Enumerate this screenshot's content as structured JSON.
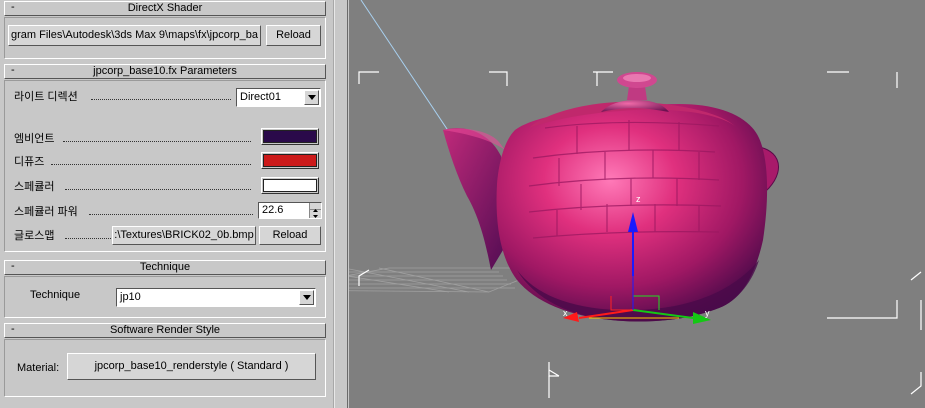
{
  "rollouts": {
    "directx": {
      "title": "DirectX Shader",
      "collapse": "-",
      "path": "gram Files\\Autodesk\\3ds Max 9\\maps\\fx\\jpcorp_ba",
      "reload": "Reload"
    },
    "params": {
      "title": "jpcorp_base10.fx Parameters",
      "collapse": "-",
      "light_label": "라이트 디렉션",
      "light_value": "Direct01",
      "ambient_label": "엠비언트",
      "ambient_color": "#2a0a4a",
      "diffuse_label": "디퓨즈",
      "diffuse_color": "#cc1a1a",
      "specular_label": "스페큘러",
      "specular_color": "#ffffff",
      "specpower_label": "스페큘러 파워",
      "specpower_value": "22.6",
      "gloss_label": "글로스맵",
      "gloss_file": ":\\Textures\\BRICK02_0b.bmp",
      "gloss_reload": "Reload"
    },
    "technique": {
      "title": "Technique",
      "collapse": "-",
      "label": "Technique",
      "value": "jp10"
    },
    "render_style": {
      "title": "Software Render Style",
      "collapse": "-",
      "label": "Material:",
      "value": "jpcorp_base10_renderstyle  ( Standard )"
    }
  },
  "viewport": {
    "axis_x": "x",
    "axis_y": "y",
    "axis_z": "z",
    "teapot_color": "#d62a78",
    "background": "#7f7f7f"
  }
}
